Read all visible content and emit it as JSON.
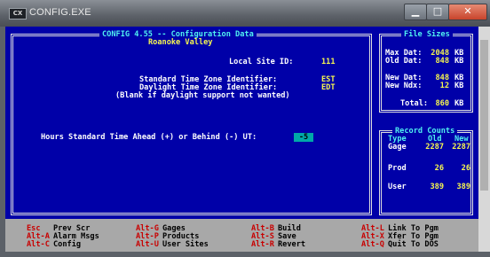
{
  "window": {
    "title": "CONFIG.EXE",
    "icon_label": "CX",
    "controls": {
      "minimize": "▁",
      "maximize": "□",
      "close": "✕"
    }
  },
  "main": {
    "title": "CONFIG 4.55 -- Configuration Data",
    "subtitle": "Roanoke Valley",
    "local_site_label": "Local Site ID:",
    "local_site_value": "111",
    "std_tz_label": "Standard Time Zone Identifier:",
    "std_tz_value": "EST",
    "dst_tz_label": "Daylight Time Zone Identifier:",
    "dst_tz_value": "EDT",
    "blank_note": "(Blank if daylight support not wanted)",
    "hours_label": "Hours Standard Time Ahead (+) or Behind (-) UT:",
    "hours_value": "-5"
  },
  "file_sizes": {
    "title": "File Sizes",
    "max_dat_label": "Max Dat:",
    "max_dat_value": "2048",
    "max_dat_unit": "KB",
    "old_dat_label": "Old Dat:",
    "old_dat_value": "848",
    "old_dat_unit": "KB",
    "new_dat_label": "New Dat:",
    "new_dat_value": "848",
    "new_dat_unit": "KB",
    "new_ndx_label": "New Ndx:",
    "new_ndx_value": "12",
    "new_ndx_unit": "KB",
    "total_label": "Total:",
    "total_value": "860",
    "total_unit": "KB"
  },
  "record_counts": {
    "title": "Record Counts",
    "headers": {
      "type": "Type",
      "old": "Old",
      "new": "New"
    },
    "rows": [
      {
        "type": "Gage",
        "old": "2287",
        "new": "2287"
      },
      {
        "type": "Prod",
        "old": "26",
        "new": "26"
      },
      {
        "type": "User",
        "old": "389",
        "new": "389"
      }
    ]
  },
  "keys": [
    {
      "key": "Esc",
      "label": "Prev Scr"
    },
    {
      "key": "Alt-A",
      "label": "Alarm Msgs"
    },
    {
      "key": "Alt-C",
      "label": "Config"
    },
    {
      "key": "Alt-G",
      "label": "Gages"
    },
    {
      "key": "Alt-P",
      "label": "Products"
    },
    {
      "key": "Alt-U",
      "label": "User Sites"
    },
    {
      "key": "Alt-B",
      "label": "Build"
    },
    {
      "key": "Alt-S",
      "label": "Save"
    },
    {
      "key": "Alt-R",
      "label": "Revert"
    },
    {
      "key": "Alt-L",
      "label": "Link To Pgm"
    },
    {
      "key": "Alt-X",
      "label": "Xfer To Pgm"
    },
    {
      "key": "Alt-Q",
      "label": "Quit To DOS"
    }
  ],
  "colors": {
    "background": "#0000a8",
    "heading": "#4ff0f0",
    "value": "#f6f650",
    "key": "#c80000",
    "close": "#c8442c"
  }
}
